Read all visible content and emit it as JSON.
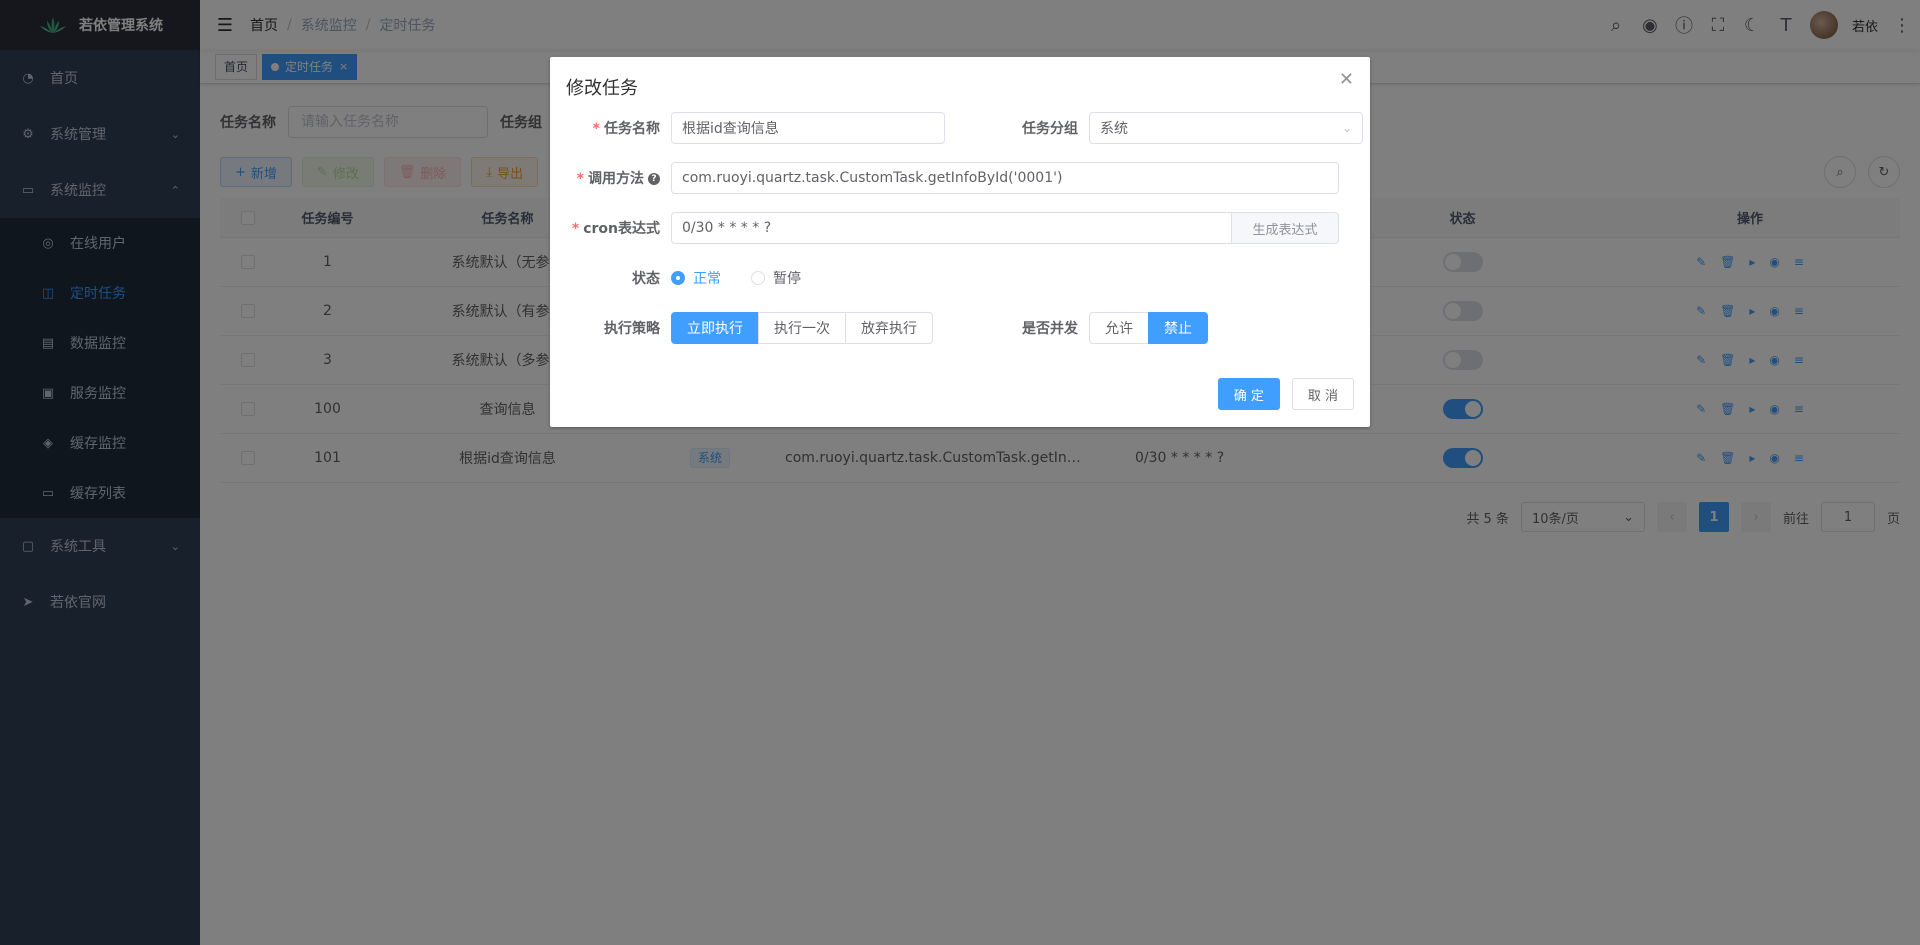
{
  "app": {
    "title": "若依管理系统"
  },
  "sidebar": {
    "items": [
      {
        "label": "首页",
        "icon": "dashboard-icon"
      },
      {
        "label": "系统管理",
        "icon": "gear-icon"
      },
      {
        "label": "系统监控",
        "icon": "monitor-icon"
      },
      {
        "label": "系统工具",
        "icon": "toolbox-icon"
      },
      {
        "label": "若依官网",
        "icon": "paper-plane-icon"
      }
    ],
    "monitor_children": [
      {
        "label": "在线用户",
        "icon": "online-icon"
      },
      {
        "label": "定时任务",
        "icon": "job-icon"
      },
      {
        "label": "数据监控",
        "icon": "druid-icon"
      },
      {
        "label": "服务监控",
        "icon": "server-icon"
      },
      {
        "label": "缓存监控",
        "icon": "redis-icon"
      },
      {
        "label": "缓存列表",
        "icon": "redis-list-icon"
      }
    ]
  },
  "navbar": {
    "breadcrumb": [
      "首页",
      "系统监控",
      "定时任务"
    ],
    "user_name": "若依"
  },
  "tags": [
    {
      "label": "首页"
    },
    {
      "label": "定时任务"
    }
  ],
  "search": {
    "label_name": "任务名称",
    "placeholder_name": "请输入任务名称",
    "label_group": "任务组"
  },
  "toolbar": {
    "add": "新增",
    "edit": "修改",
    "delete": "删除",
    "export": "导出"
  },
  "table": {
    "headers": {
      "id": "任务编号",
      "name": "任务名称",
      "status": "状态",
      "ops": "操作"
    },
    "rows": [
      {
        "id": "1",
        "name": "系统默认（无参）",
        "group": "",
        "method": "",
        "cron": "",
        "on": false
      },
      {
        "id": "2",
        "name": "系统默认（有参）",
        "group": "",
        "method": "",
        "cron": "",
        "on": false
      },
      {
        "id": "3",
        "name": "系统默认（多参）",
        "group": "",
        "method": "",
        "cron": "",
        "on": false
      },
      {
        "id": "100",
        "name": "查询信息",
        "group": "",
        "method": "",
        "cron": "",
        "on": true
      },
      {
        "id": "101",
        "name": "根据id查询信息",
        "group": "系统",
        "method": "com.ruoyi.quartz.task.CustomTask.getInfoById('0001')",
        "cron": "0/30 * * * * ?",
        "on": true
      }
    ]
  },
  "pagination": {
    "total": "共 5 条",
    "page_size": "10条/页",
    "current": "1",
    "goto_label": "前往",
    "goto_value": "1",
    "page_suffix": "页"
  },
  "dialog": {
    "title": "修改任务",
    "job_name_label": "任务名称",
    "job_name_value": "根据id查询信息",
    "job_group_label": "任务分组",
    "job_group_value": "系统",
    "invoke_label": "调用方法",
    "invoke_value": "com.ruoyi.quartz.task.CustomTask.getInfoById('0001')",
    "cron_label": "cron表达式",
    "cron_value": "0/30 * * * * ?",
    "cron_button": "生成表达式",
    "status_label": "状态",
    "status_options": [
      "正常",
      "暂停"
    ],
    "policy_label": "执行策略",
    "policy_options": [
      "立即执行",
      "执行一次",
      "放弃执行"
    ],
    "concurrent_label": "是否并发",
    "concurrent_options": [
      "允许",
      "禁止"
    ],
    "confirm": "确 定",
    "cancel": "取 消"
  },
  "colors": {
    "primary": "#409eff",
    "sidebar": "#304156",
    "danger": "#f56c6c"
  }
}
